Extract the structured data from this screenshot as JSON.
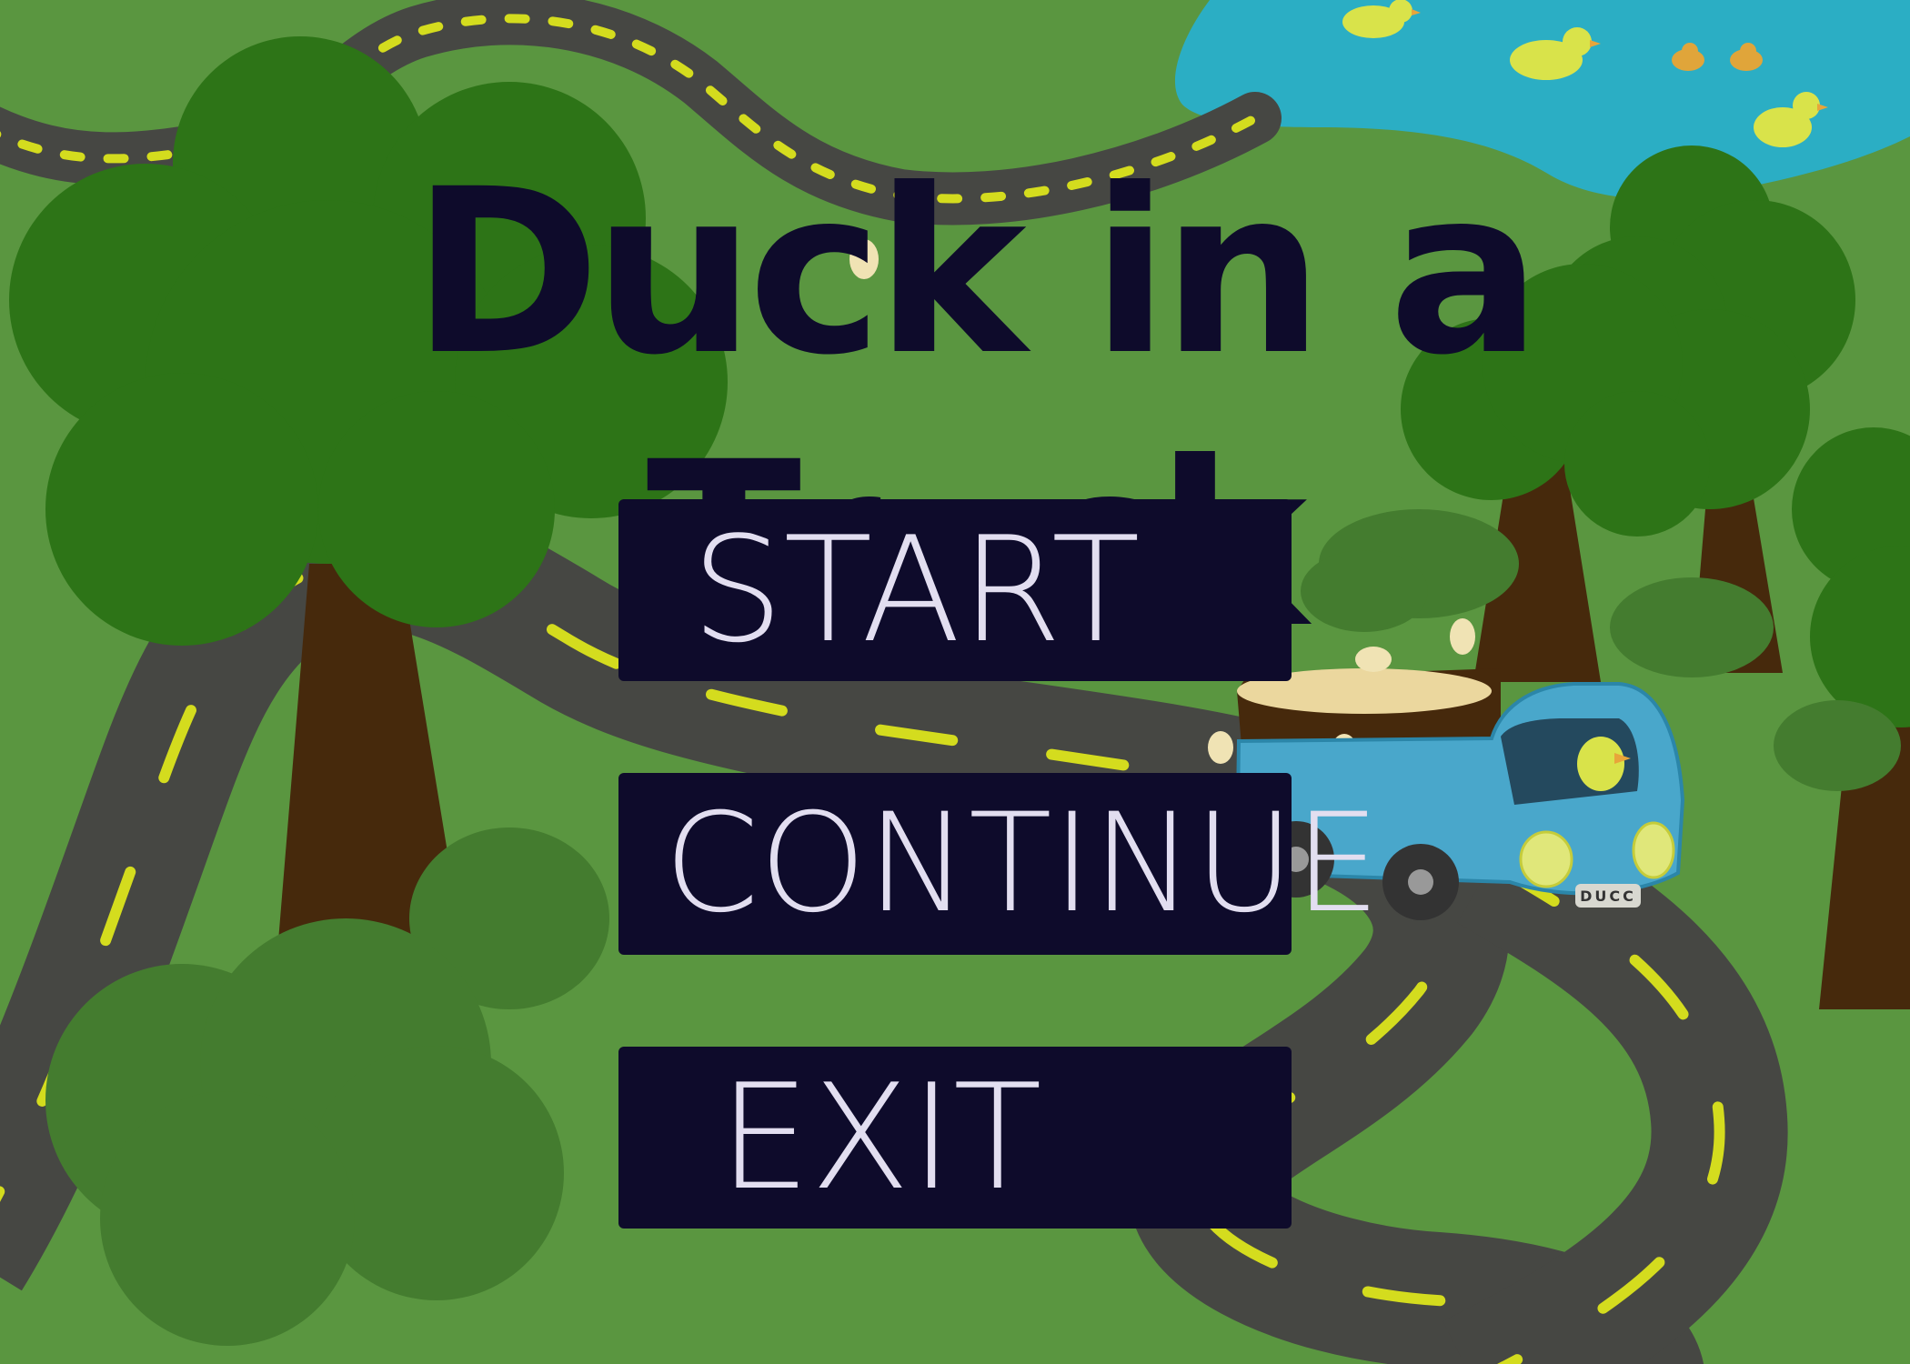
{
  "game": {
    "title": "Duck in a Truck",
    "truck_plate": "DUCC"
  },
  "menu": {
    "start_label": "START",
    "continue_label": "CONTINUE",
    "exit_label": "EXIT"
  },
  "colors": {
    "grass": "#5a9640",
    "road": "#464743",
    "road_line": "#d4dc1e",
    "lake": "#2baec4",
    "tree_canopy": "#2d7417",
    "bush": "#447c2f",
    "trunk": "#46290c",
    "truck": "#49a7cb",
    "button_bg": "#0e0b2b",
    "button_text": "#e2def0",
    "title_text": "#0e0b2b"
  }
}
